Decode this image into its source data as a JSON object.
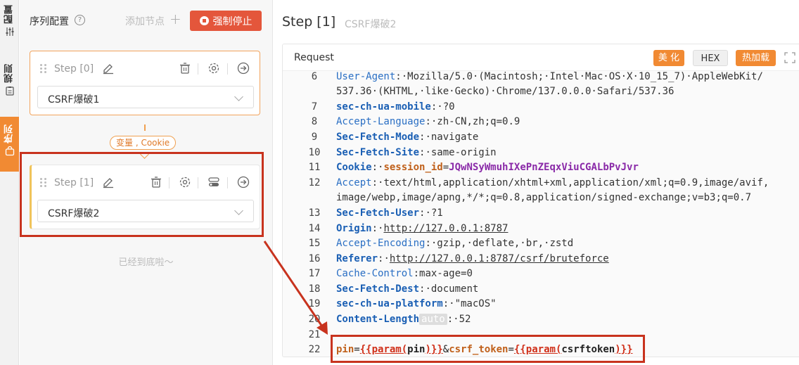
{
  "vtabs": {
    "config": "配置",
    "rules": "规则",
    "sequence": "序列"
  },
  "left": {
    "title": "序列配置",
    "help": "?",
    "add_node": "添加节点",
    "add_plus": "+",
    "stop_label": "强制停止",
    "steps": [
      {
        "name": "Step [0]",
        "selected": "CSRF爆破1"
      },
      {
        "name": "Step [1]",
        "selected": "CSRF爆破2"
      }
    ],
    "var_tag": "变量 , Cookie",
    "bottom_note": "已经到底啦～"
  },
  "right": {
    "step_title": "Step [1]",
    "step_sub": "CSRF爆破2",
    "request_label": "Request",
    "buttons": {
      "beautify": "美 化",
      "hex": "HEX",
      "hotload": "热加载"
    }
  },
  "code": {
    "line_numbers": [
      "6",
      "",
      "7",
      "8",
      "9",
      "10",
      "11",
      "12",
      "",
      "13",
      "14",
      "15",
      "16",
      "17",
      "18",
      "19",
      "20",
      "21",
      "22"
    ],
    "l6": {
      "name": "User-Agent",
      "value": "Mozilla/5.0·(Macintosh;·Intel·Mac·OS·X·10_15_7)·AppleWebKit/"
    },
    "l6b": "537.36·(KHTML,·like·Gecko)·Chrome/137.0.0.0·Safari/537.36",
    "l7": {
      "name": "sec-ch-ua-mobile",
      "value": "?0"
    },
    "l8": {
      "name": "Accept-Language",
      "value": "zh-CN,zh;q=0.9"
    },
    "l9": {
      "name": "Sec-Fetch-Mode",
      "value": "navigate"
    },
    "l10": {
      "name": "Sec-Fetch-Site",
      "value": "same-origin"
    },
    "l11": {
      "name": "Cookie",
      "key": "session_id",
      "value": "JQwNSyWmuhIXePnZEqxViuCGALbPvJvr"
    },
    "l12": {
      "name": "Accept",
      "value": "text/html,application/xhtml+xml,application/xml;q=0.9,image/avif,"
    },
    "l12b": "image/webp,image/apng,*/*;q=0.8,application/signed-exchange;v=b3;q=0.7",
    "l13": {
      "name": "Sec-Fetch-User",
      "value": "?1"
    },
    "l14": {
      "name": "Origin",
      "value": "http://127.0.0.1:8787"
    },
    "l15": {
      "name": "Accept-Encoding",
      "value": "gzip,·deflate,·br,·zstd"
    },
    "l16": {
      "name": "Referer",
      "value": "http://127.0.0.1:8787/csrf/bruteforce"
    },
    "l17": {
      "name": "Cache-Control",
      "value": "max-age=0"
    },
    "l18": {
      "name": "Sec-Fetch-Dest",
      "value": "document"
    },
    "l19": {
      "name": "sec-ch-ua-platform",
      "value": "\"macOS\""
    },
    "l20": {
      "name": "Content-Length",
      "badge": "auto",
      "value": "52"
    },
    "l22": {
      "k1": "pin",
      "t1_open": "{{param(",
      "a1": "pin",
      "t1_close": ")}}",
      "amp": "&",
      "k2": "csrf_token",
      "t2_open": "{{param(",
      "a2": "csrftoken",
      "t2_close": ")}}"
    }
  },
  "colors": {
    "accent": "#f18a33",
    "danger": "#e4563b",
    "annotation": "#c8331e"
  }
}
